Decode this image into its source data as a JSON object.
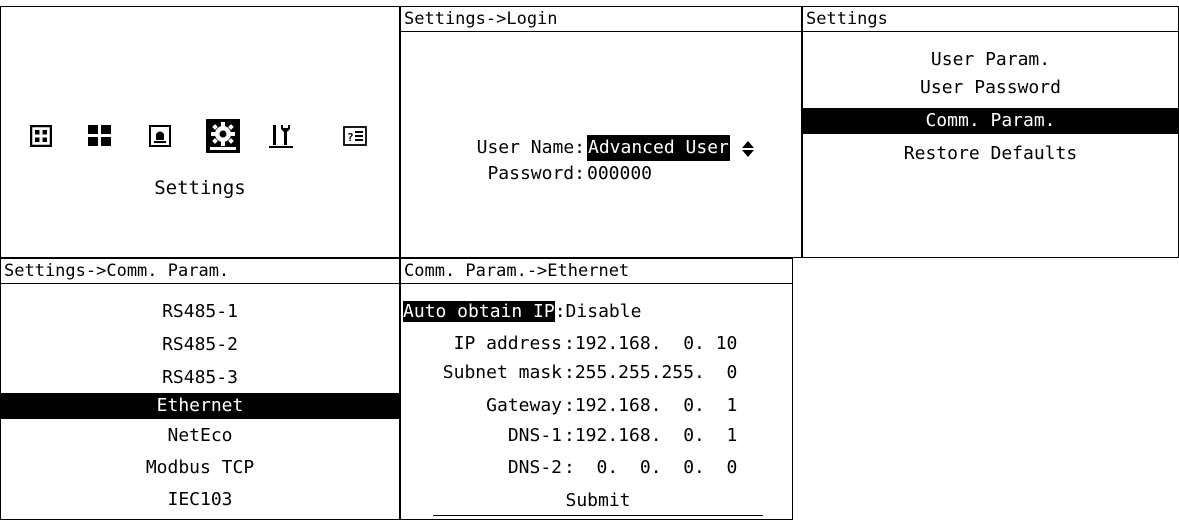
{
  "main_menu": {
    "caption": "Settings",
    "icons": [
      "grid-icon",
      "blocks-icon",
      "alarm-bell-icon",
      "settings-gear-icon",
      "tools-icon",
      "help-info-icon"
    ],
    "selected_icon": "settings-gear-icon"
  },
  "login": {
    "header": "Settings->Login",
    "user_name_label": "User Name:",
    "user_name_value": "Advanced User",
    "password_label": "Password:",
    "password_value": "000000"
  },
  "settings": {
    "header": "Settings",
    "items": [
      "User Param.",
      "User Password",
      "Comm. Param.",
      "Restore Defaults"
    ],
    "selected_index": 2
  },
  "comm_param": {
    "header": "Settings->Comm. Param.",
    "items": [
      "RS485-1",
      "RS485-2",
      "RS485-3",
      "Ethernet",
      "NetEco",
      "Modbus TCP",
      "IEC103"
    ],
    "selected_index": 3
  },
  "ethernet": {
    "header": "Comm. Param.->Ethernet",
    "auto_ip_label": "Auto obtain IP",
    "auto_ip_value": ":Disable",
    "fields": [
      {
        "label": "IP address",
        "value": ":192.168.  0. 10"
      },
      {
        "label": "Subnet mask",
        "value": ":255.255.255.  0"
      },
      {
        "label": "Gateway",
        "value": ":192.168.  0.  1"
      },
      {
        "label": "DNS-1",
        "value": ":192.168.  0.  1"
      },
      {
        "label": "DNS-2",
        "value": ":  0.  0.  0.  0"
      }
    ],
    "submit_label": "Submit"
  },
  "colors": {
    "foreground": "#000000",
    "background": "#ffffff",
    "highlight": "#000000"
  }
}
